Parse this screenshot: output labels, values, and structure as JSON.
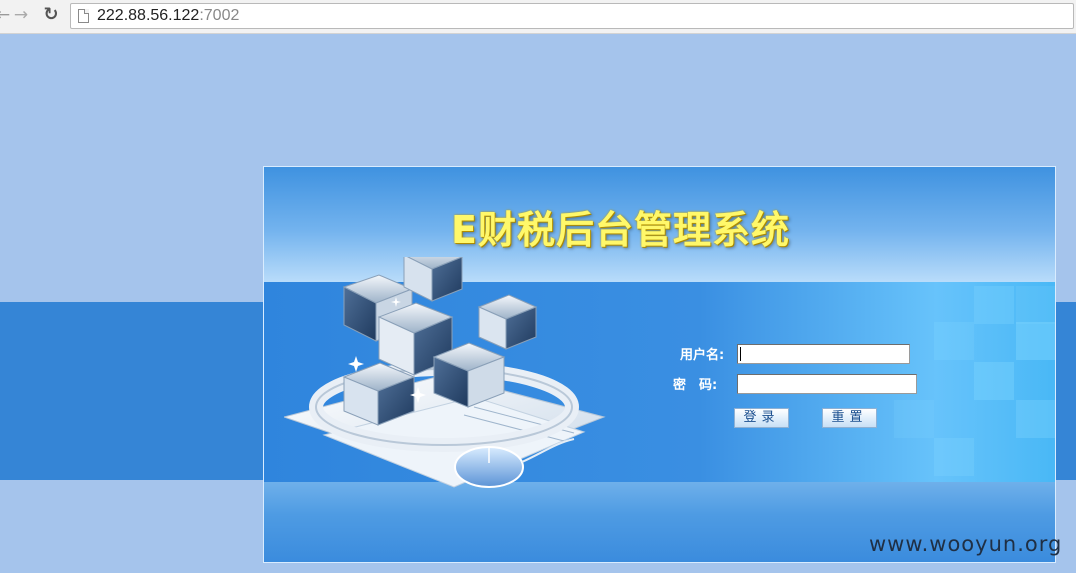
{
  "browser": {
    "url_host": "222.88.56.122",
    "url_port": ":7002",
    "back_icon": "back-arrow-icon",
    "forward_icon": "forward-arrow-icon",
    "reload_icon": "reload-icon",
    "page_icon": "page-icon"
  },
  "login": {
    "title": "E财税后台管理系统",
    "username_label": "用户名:",
    "password_label": "密　码:",
    "username_value": "",
    "password_value": "",
    "login_button": "登录",
    "reset_button": "重置"
  },
  "watermark": "www.wooyun.org",
  "colors": {
    "page_background": "#a5c4ec",
    "band": "#3585d6",
    "title": "#fff86a"
  }
}
